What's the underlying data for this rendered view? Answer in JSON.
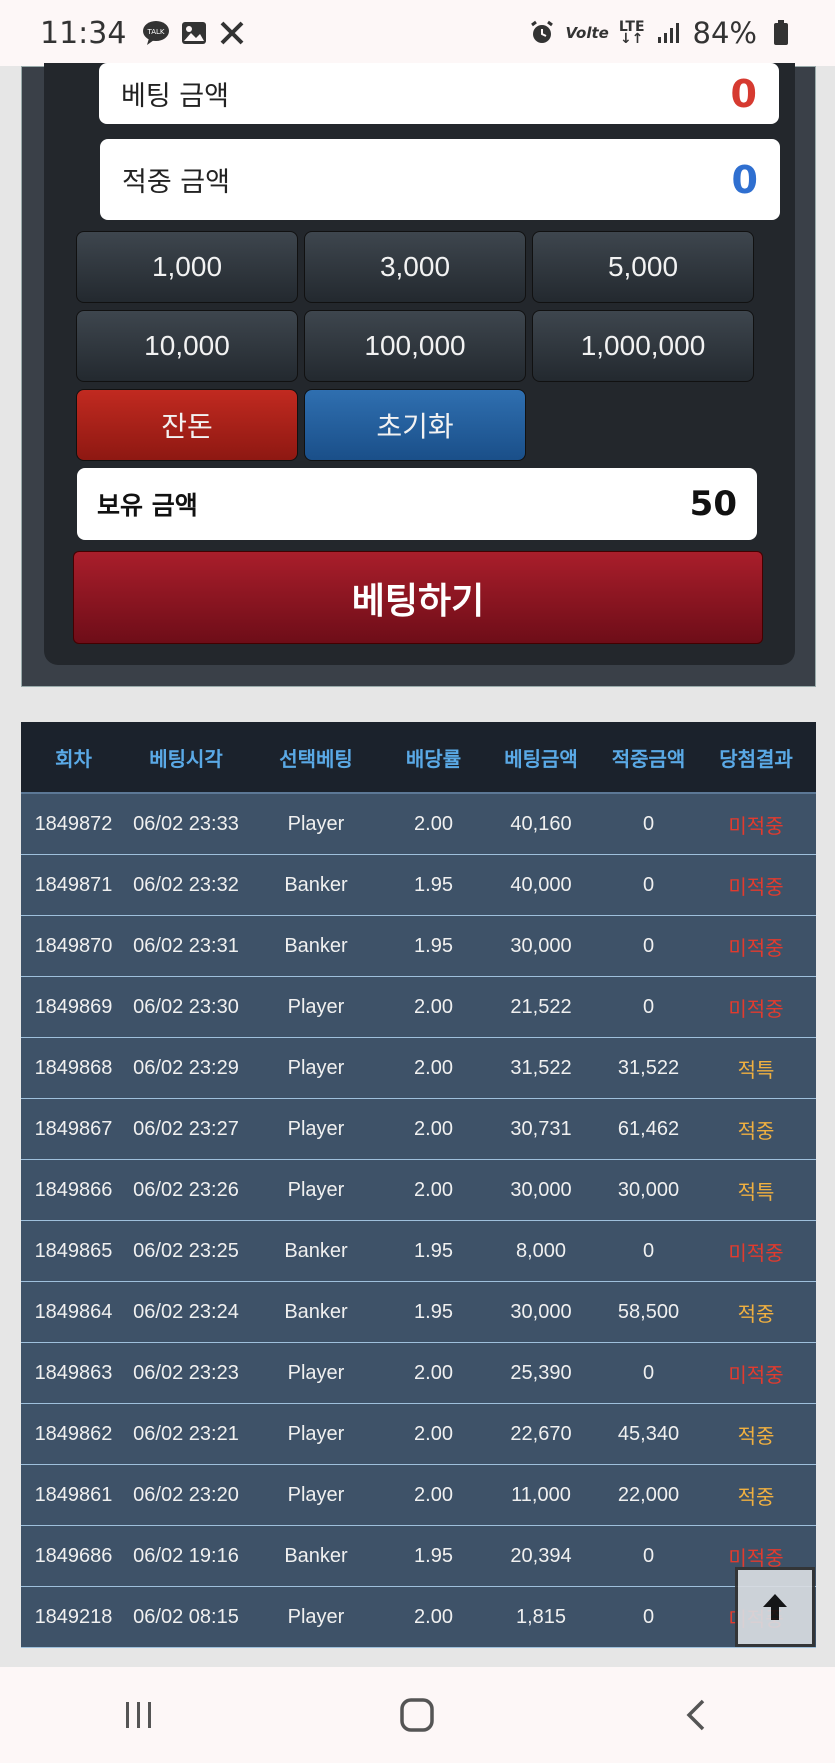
{
  "status_bar": {
    "time": "11:34",
    "talk_badge": "TALK",
    "volte": "Volte",
    "lte": "LTE",
    "battery": "84%"
  },
  "bet_panel": {
    "bet_amount_label": "베팅 금액",
    "bet_amount_value": "0",
    "hit_amount_label": "적중 금액",
    "hit_amount_value": "0",
    "chips": [
      "1,000",
      "3,000",
      "5,000",
      "10,000",
      "100,000",
      "1,000,000"
    ],
    "change_label": "잔돈",
    "reset_label": "초기화",
    "holding_label": "보유 금액",
    "holding_value": "50",
    "bet_button": "베팅하기"
  },
  "history": {
    "headers": [
      "회차",
      "베팅시각",
      "선택베팅",
      "배당률",
      "베팅금액",
      "적중금액",
      "당첨결과"
    ],
    "rows": [
      [
        "1849872",
        "06/02 23:33",
        "Player",
        "2.00",
        "40,160",
        "0",
        "미적중"
      ],
      [
        "1849871",
        "06/02 23:32",
        "Banker",
        "1.95",
        "40,000",
        "0",
        "미적중"
      ],
      [
        "1849870",
        "06/02 23:31",
        "Banker",
        "1.95",
        "30,000",
        "0",
        "미적중"
      ],
      [
        "1849869",
        "06/02 23:30",
        "Player",
        "2.00",
        "21,522",
        "0",
        "미적중"
      ],
      [
        "1849868",
        "06/02 23:29",
        "Player",
        "2.00",
        "31,522",
        "31,522",
        "적특"
      ],
      [
        "1849867",
        "06/02 23:27",
        "Player",
        "2.00",
        "30,731",
        "61,462",
        "적중"
      ],
      [
        "1849866",
        "06/02 23:26",
        "Player",
        "2.00",
        "30,000",
        "30,000",
        "적특"
      ],
      [
        "1849865",
        "06/02 23:25",
        "Banker",
        "1.95",
        "8,000",
        "0",
        "미적중"
      ],
      [
        "1849864",
        "06/02 23:24",
        "Banker",
        "1.95",
        "30,000",
        "58,500",
        "적중"
      ],
      [
        "1849863",
        "06/02 23:23",
        "Player",
        "2.00",
        "25,390",
        "0",
        "미적중"
      ],
      [
        "1849862",
        "06/02 23:21",
        "Player",
        "2.00",
        "22,670",
        "45,340",
        "적중"
      ],
      [
        "1849861",
        "06/02 23:20",
        "Player",
        "2.00",
        "11,000",
        "22,000",
        "적중"
      ],
      [
        "1849686",
        "06/02 19:16",
        "Banker",
        "1.95",
        "20,394",
        "0",
        "미적중"
      ],
      [
        "1849218",
        "06/02 08:15",
        "Player",
        "2.00",
        "1,815",
        "0",
        "미적중"
      ]
    ]
  },
  "colors": {
    "bet_amount": "#d63a30",
    "hit_amount": "#2f6fd0",
    "miss": "#e23b2e",
    "hit": "#f0b040"
  }
}
